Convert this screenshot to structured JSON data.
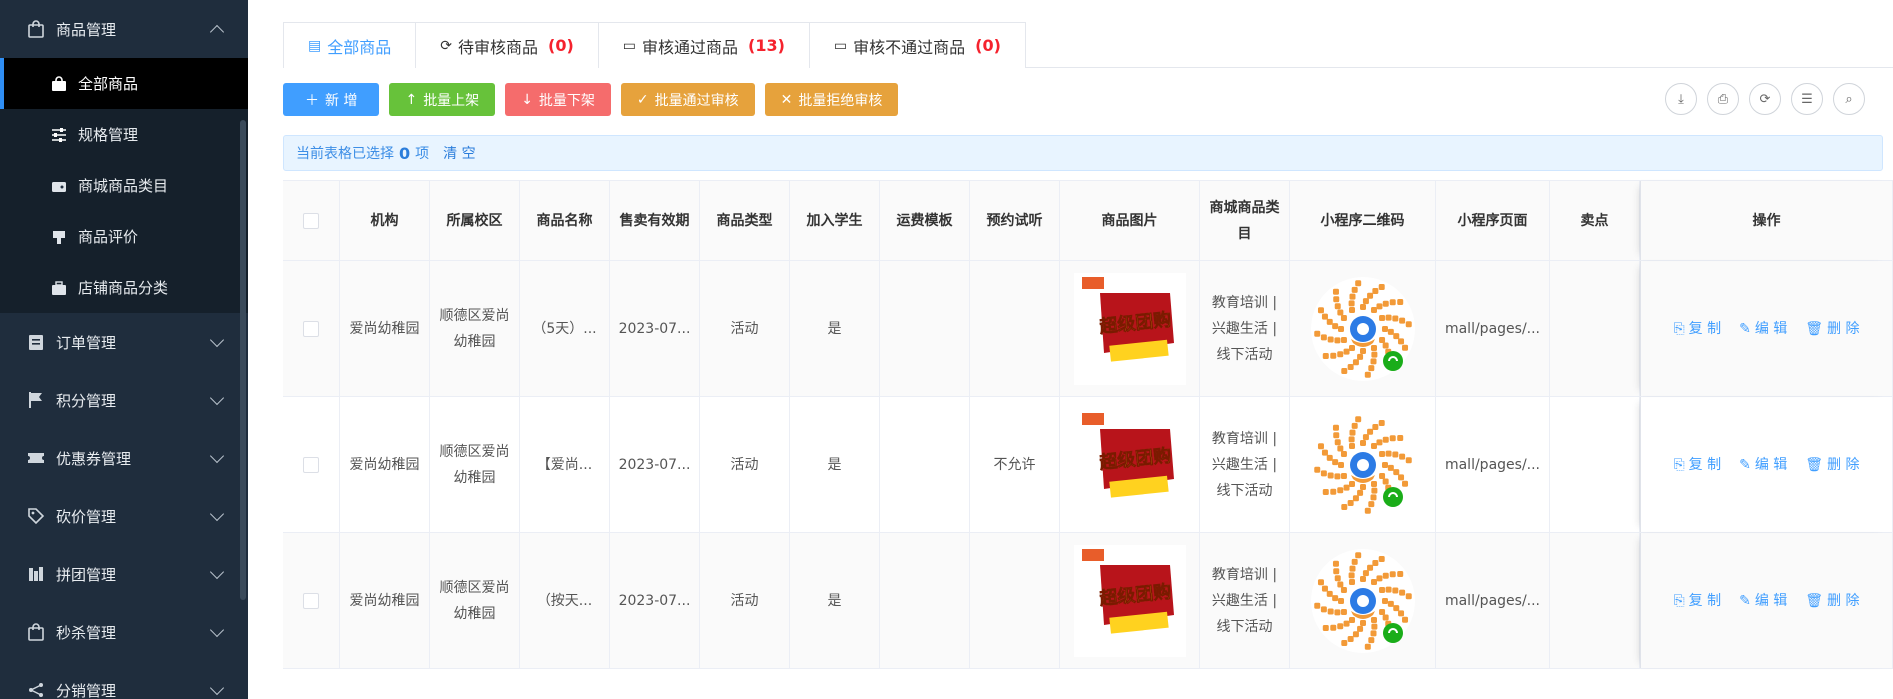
{
  "sidebar": {
    "goods_group": "商品管理",
    "sub_items": [
      {
        "label": "全部商品",
        "icon": "bag-icon",
        "active": true
      },
      {
        "label": "规格管理",
        "icon": "sliders-icon"
      },
      {
        "label": "商城商品类目",
        "icon": "wallet-icon"
      },
      {
        "label": "商品评价",
        "icon": "thumb-icon"
      },
      {
        "label": "店铺商品分类",
        "icon": "briefcase-icon"
      }
    ],
    "groups": [
      {
        "label": "订单管理",
        "icon": "clipboard-icon"
      },
      {
        "label": "积分管理",
        "icon": "flag-icon"
      },
      {
        "label": "优惠券管理",
        "icon": "ticket-icon"
      },
      {
        "label": "砍价管理",
        "icon": "tag-icon"
      },
      {
        "label": "拼团管理",
        "icon": "stats-icon"
      },
      {
        "label": "秒杀管理",
        "icon": "bag-icon"
      },
      {
        "label": "分销管理",
        "icon": "share-icon"
      }
    ]
  },
  "tabs": [
    {
      "label": "全部商品",
      "count": ""
    },
    {
      "label": "待审核商品",
      "count": "(0)"
    },
    {
      "label": "审核通过商品",
      "count": "(13)"
    },
    {
      "label": "审核不通过商品",
      "count": "(0)"
    }
  ],
  "toolbar": {
    "add": "新 增",
    "on_shelf": "批量上架",
    "off_shelf": "批量下架",
    "approve": "批量通过审核",
    "reject": "批量拒绝审核"
  },
  "alert": {
    "prefix": "当前表格已选择",
    "count": "0",
    "suffix": "项",
    "clear": "清 空"
  },
  "table": {
    "headers": [
      "机构",
      "所属校区",
      "商品名称",
      "售卖有效期",
      "商品类型",
      "加入学生",
      "运费模板",
      "预约试听",
      "商品图片",
      "商城商品类目",
      "小程序二维码",
      "小程序页面",
      "卖点",
      "操作"
    ],
    "rows": [
      {
        "org": "爱尚幼稚园",
        "campus": "顺德区爱尚幼稚园",
        "name": "（5天）...",
        "valid": "2023-07...",
        "type": "活动",
        "join": "是",
        "freight": "",
        "trial": "",
        "category": "教育培训 | 兴趣生活 | 线下活动",
        "page": "mall/pages/...",
        "point": ""
      },
      {
        "org": "爱尚幼稚园",
        "campus": "顺德区爱尚幼稚园",
        "name": "【爱尚...",
        "valid": "2023-07...",
        "type": "活动",
        "join": "是",
        "freight": "",
        "trial": "不允许",
        "category": "教育培训 | 兴趣生活 | 线下活动",
        "page": "mall/pages/...",
        "point": ""
      },
      {
        "org": "爱尚幼稚园",
        "campus": "顺德区爱尚幼稚园",
        "name": "（按天...",
        "valid": "2023-07...",
        "type": "活动",
        "join": "是",
        "freight": "",
        "trial": "",
        "category": "教育培训 | 兴趣生活 | 线下活动",
        "page": "mall/pages/...",
        "point": ""
      }
    ],
    "ops": {
      "copy": "复 制",
      "edit": "编 辑",
      "delete": "删 除"
    },
    "thumb_text": "超级团购"
  }
}
